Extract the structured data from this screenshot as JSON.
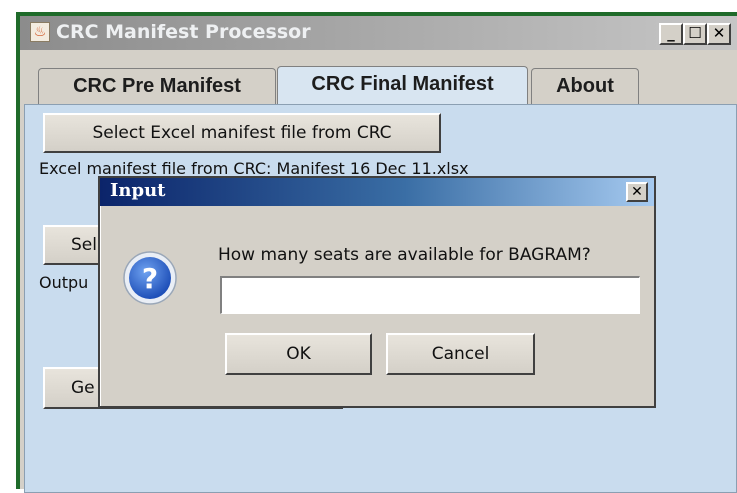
{
  "window": {
    "title": "CRC Manifest Processor",
    "minimize_glyph": "_",
    "maximize_glyph": "☐",
    "close_glyph": "✕",
    "app_icon_glyph": "♨"
  },
  "tabs": [
    {
      "label": "CRC Pre Manifest",
      "active": false
    },
    {
      "label": "CRC Final Manifest",
      "active": true
    },
    {
      "label": "About",
      "active": false
    }
  ],
  "panel": {
    "select_excel_button": "Select Excel manifest file from CRC",
    "excel_file_label": "Excel manifest file from CRC:  Manifest 16 Dec 11.xlsx",
    "select_output_button_partial": "Sel",
    "output_label_partial": "Outpu",
    "generate_button_partial": "Ge"
  },
  "dialog": {
    "title": "Input",
    "close_glyph": "✕",
    "prompt": "How many seats are available for BAGRAM?",
    "input_value": "",
    "ok_label": "OK",
    "cancel_label": "Cancel",
    "icon": "question-icon"
  },
  "colors": {
    "panel_bg": "#c9dcee",
    "dialog_title_start": "#0b246a",
    "dialog_title_end": "#a6caf0",
    "window_border": "#1f6b2a"
  }
}
